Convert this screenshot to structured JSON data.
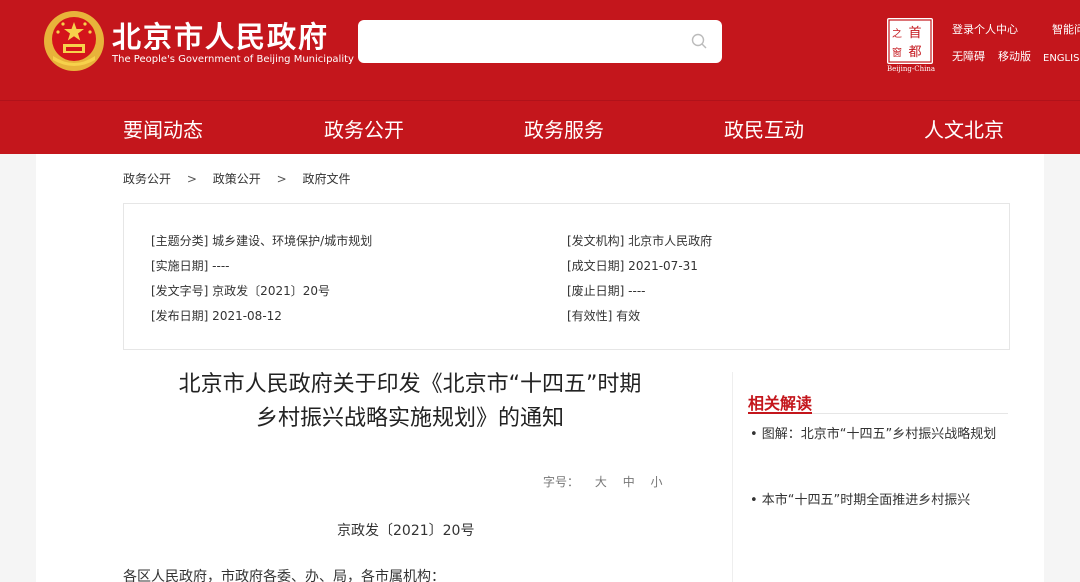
{
  "header": {
    "site_title": "北京市人民政府",
    "site_subtitle": "The People's Government of Beijing Municipality",
    "search": {
      "value": "",
      "placeholder": ""
    },
    "capital_logo": {
      "chars": [
        "首",
        "都",
        "之",
        "窗"
      ],
      "caption": "Beijing-China"
    },
    "links": {
      "login": "登录个人中心",
      "smart": "智能问",
      "accessibility": "无障碍",
      "mobile": "移动版",
      "english": "ENGLISH"
    },
    "colors": {
      "brand": "#c4161c"
    }
  },
  "nav": {
    "items": [
      "要闻动态",
      "政务公开",
      "政务服务",
      "政民互动",
      "人文北京"
    ]
  },
  "breadcrumb": {
    "items": [
      "政务公开",
      "政策公开",
      "政府文件"
    ],
    "separator": ">"
  },
  "info": {
    "topic": "[主题分类] 城乡建设、环境保护/城市规划",
    "issuer": "[发文机构] 北京市人民政府",
    "effective_date": "[实施日期] ----",
    "written_date": "[成文日期] 2021-07-31",
    "doc_no": "[发文字号] 京政发〔2021〕20号",
    "abolish_date": "[废止日期] ----",
    "publish_date": "[发布日期] 2021-08-12",
    "validity": "[有效性] 有效"
  },
  "document": {
    "title_line1": "北京市人民政府关于印发《北京市“十四五”时期",
    "title_line2": "乡村振兴战略实施规划》的通知",
    "font_size_label": "字号：",
    "font_sizes": [
      "大",
      "中",
      "小"
    ],
    "number": "京政发〔2021〕20号",
    "salutation": "各区人民政府，市政府各委、办、局，各市属机构："
  },
  "related": {
    "title": "相关解读",
    "items": [
      "• 图解：北京市“十四五”乡村振兴战略规划",
      "• 本市“十四五”时期全面推进乡村振兴"
    ]
  }
}
